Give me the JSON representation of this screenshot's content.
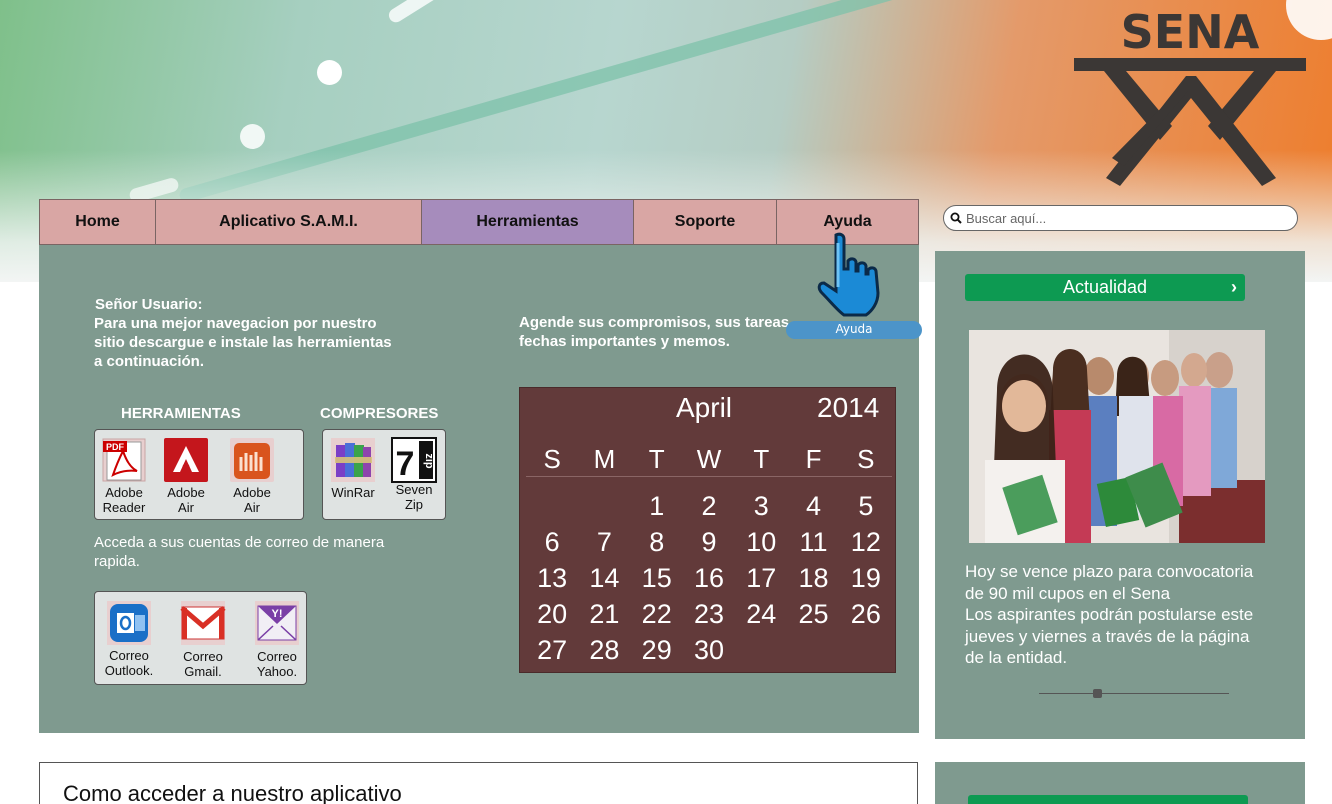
{
  "brand": {
    "logo_text": "SENA"
  },
  "nav": {
    "items": [
      {
        "label": "Home"
      },
      {
        "label": "Aplicativo S.A.M.I."
      },
      {
        "label": "Herramientas"
      },
      {
        "label": "Soporte"
      },
      {
        "label": "Ayuda"
      }
    ],
    "active_index": 2
  },
  "search": {
    "placeholder": "Buscar aquí..."
  },
  "main": {
    "intro": {
      "greeting": "Señor Usuario:",
      "line1": "Para una mejor navegacion por nuestro",
      "line2": "sitio descargue e instale las herramientas",
      "line3": "a continuación."
    },
    "agenda": {
      "line1": "Agende sus compromisos, sus tareas,",
      "line2": "fechas importantes y memos."
    },
    "tools_label": "HERRAMIENTAS",
    "compressors_label": "COMPRESORES",
    "tools": [
      {
        "line1": "Adobe",
        "line2": "Reader",
        "icon": "pdf-icon"
      },
      {
        "line1": "Adobe",
        "line2": "Air",
        "icon": "adobe-air-icon"
      },
      {
        "line1": "Adobe",
        "line2": "Air",
        "icon": "adobe-air-alt-icon"
      }
    ],
    "compressors": [
      {
        "line1": "WinRar",
        "line2": "",
        "icon": "winrar-icon"
      },
      {
        "line1": "Seven",
        "line2": "Zip",
        "icon": "7zip-icon"
      }
    ],
    "mail_text_1": "Acceda a sus cuentas de correo de manera",
    "mail_text_2": "rapida.",
    "mail": [
      {
        "line1": "Correo",
        "line2": "Outlook.",
        "icon": "outlook-icon"
      },
      {
        "line1": "Correo",
        "line2": "Gmail.",
        "icon": "gmail-icon"
      },
      {
        "line1": "Correo",
        "line2": "Yahoo.",
        "icon": "yahoo-icon"
      }
    ]
  },
  "calendar": {
    "month": "April",
    "year": "2014",
    "weekdays": [
      "S",
      "M",
      "T",
      "W",
      "T",
      "F",
      "S"
    ],
    "weeks": [
      [
        "",
        "",
        "1",
        "2",
        "3",
        "4",
        "5"
      ],
      [
        "6",
        "7",
        "8",
        "9",
        "10",
        "11",
        "12"
      ],
      [
        "13",
        "14",
        "15",
        "16",
        "17",
        "18",
        "19"
      ],
      [
        "20",
        "21",
        "22",
        "23",
        "24",
        "25",
        "26"
      ],
      [
        "27",
        "28",
        "29",
        "30",
        "",
        "",
        ""
      ]
    ]
  },
  "tooltip": {
    "label": "Ayuda"
  },
  "sidebar": {
    "header": "Actualidad",
    "news_line1": "Hoy se vence plazo para convocatoria",
    "news_line2": "de 90 mil cupos en el Sena",
    "news_line3": "Los aspirantes podrán postularse este",
    "news_line4": "jueves y viernes a través de la página",
    "news_line5": "de la entidad."
  },
  "lower": {
    "title": "Como acceder a nuestro aplicativo"
  },
  "colors": {
    "panel": "#7f9a8f",
    "nav": "#d9a6a4",
    "nav_active": "#a68cbc",
    "calendar": "#623a3a",
    "accent_green": "#0d9a52",
    "sena_orange": "#ee7d2c"
  }
}
